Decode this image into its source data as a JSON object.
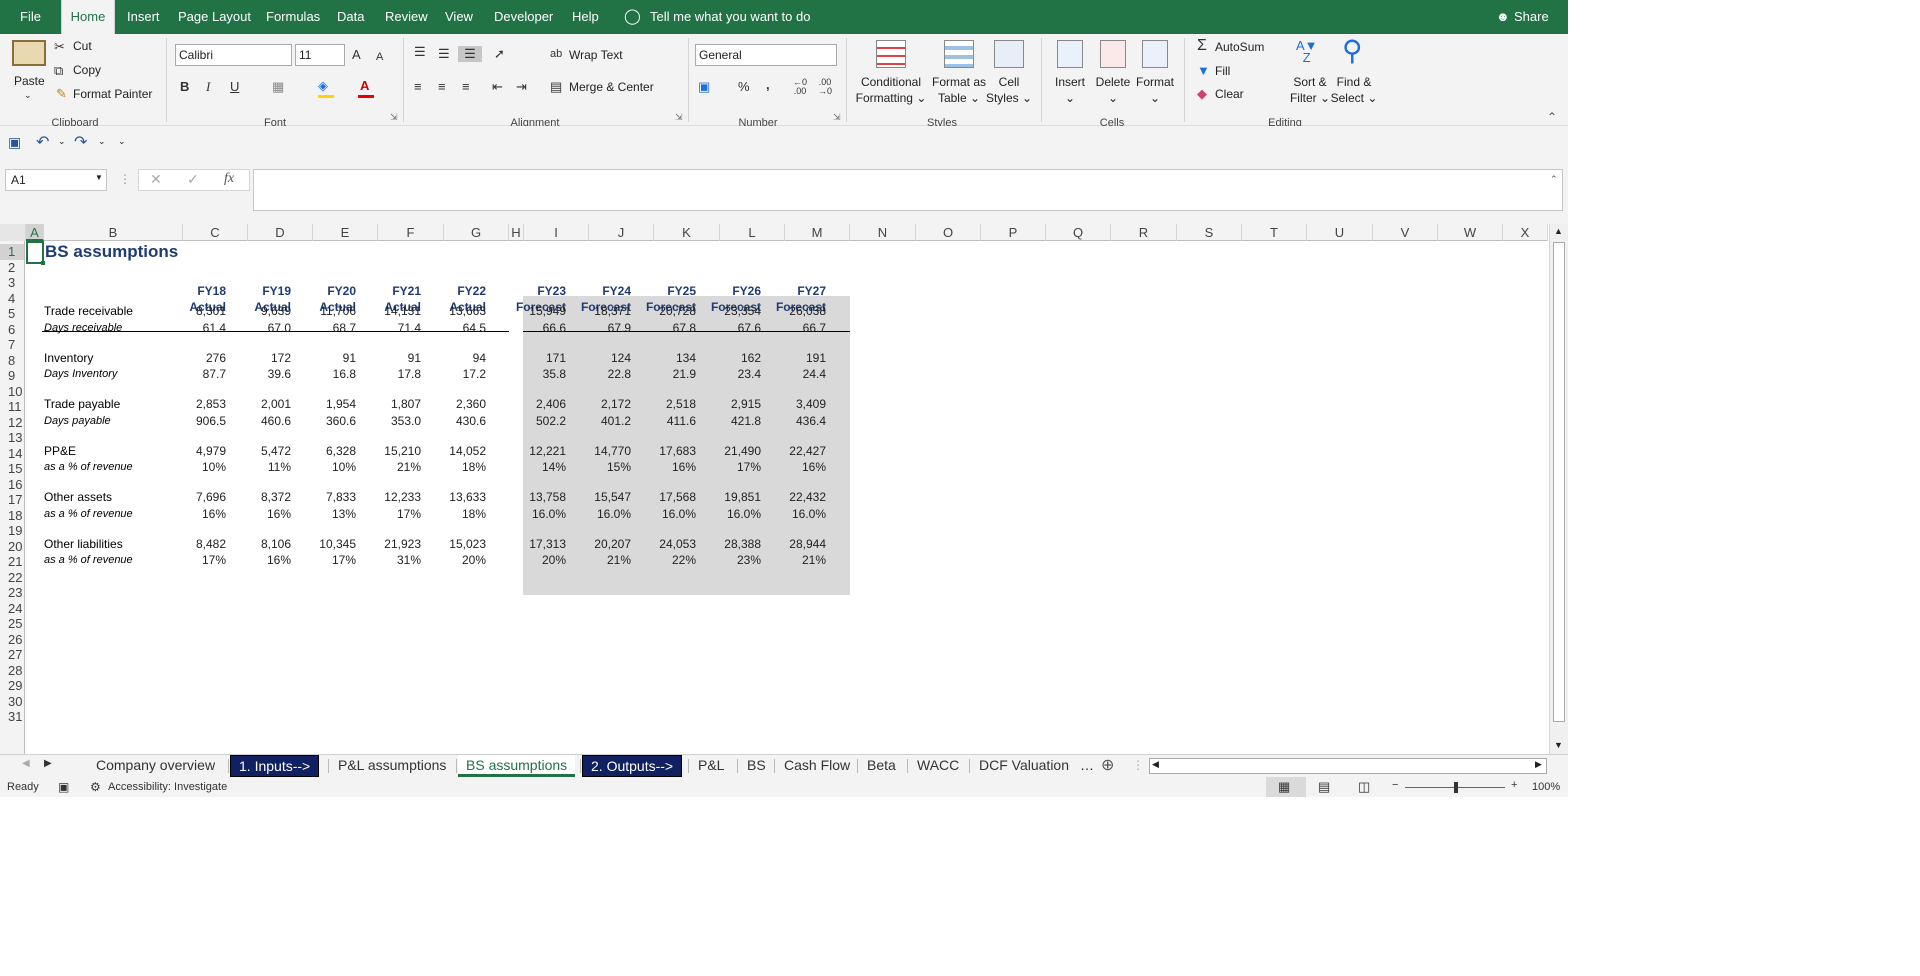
{
  "menu": {
    "tabs": [
      "File",
      "Home",
      "Insert",
      "Page Layout",
      "Formulas",
      "Data",
      "Review",
      "View",
      "Developer",
      "Help"
    ],
    "tell_me": "Tell me what you want to do",
    "share": "Share"
  },
  "ribbon": {
    "clipboard": {
      "paste": "Paste",
      "cut": "Cut",
      "copy": "Copy",
      "format_painter": "Format Painter",
      "label": "Clipboard"
    },
    "font": {
      "name": "Calibri",
      "size": "11",
      "label": "Font",
      "bold": "B",
      "italic": "I",
      "underline": "U",
      "grow": "A",
      "shrink": "A"
    },
    "alignment": {
      "wrap": "Wrap Text",
      "merge": "Merge & Center",
      "label": "Alignment"
    },
    "number": {
      "format": "General",
      "percent": "%",
      "comma": ",",
      "label": "Number"
    },
    "styles": {
      "conditional": "Conditional",
      "formatting": "Formatting",
      "format_as": "Format as",
      "table": "Table",
      "cell": "Cell",
      "cell_styles": "Styles",
      "label": "Styles"
    },
    "cells": {
      "insert": "Insert",
      "delete": "Delete",
      "format": "Format",
      "label": "Cells"
    },
    "editing": {
      "autosum": "AutoSum",
      "fill": "Fill",
      "clear": "Clear",
      "sort": "Sort &",
      "filter": "Filter",
      "find": "Find &",
      "select": "Select",
      "label": "Editing"
    }
  },
  "formula_bar": {
    "name_box": "A1",
    "fx": "fx",
    "value": ""
  },
  "columns": [
    "A",
    "B",
    "C",
    "D",
    "E",
    "F",
    "G",
    "H",
    "I",
    "J",
    "K",
    "L",
    "M",
    "N",
    "O",
    "P",
    "Q",
    "R",
    "S",
    "T",
    "U",
    "V",
    "W",
    "X"
  ],
  "rows": [
    "1",
    "2",
    "3",
    "4",
    "5",
    "6",
    "7",
    "8",
    "9",
    "10",
    "11",
    "12",
    "13",
    "14",
    "15",
    "16",
    "17",
    "18",
    "19",
    "20",
    "21",
    "22",
    "23",
    "24",
    "25",
    "26",
    "27",
    "28",
    "29",
    "30",
    "31"
  ],
  "sheet": {
    "title": "BS assumptions",
    "years": [
      {
        "fy": "FY18",
        "kind": "Actual"
      },
      {
        "fy": "FY19",
        "kind": "Actual"
      },
      {
        "fy": "FY20",
        "kind": "Actual"
      },
      {
        "fy": "FY21",
        "kind": "Actual"
      },
      {
        "fy": "FY22",
        "kind": "Actual"
      },
      {
        "fy": "FY23",
        "kind": "Forecast"
      },
      {
        "fy": "FY24",
        "kind": "Forecast"
      },
      {
        "fy": "FY25",
        "kind": "Forecast"
      },
      {
        "fy": "FY26",
        "kind": "Forecast"
      },
      {
        "fy": "FY27",
        "kind": "Forecast"
      }
    ],
    "blocks": [
      {
        "label": "Trade receivable",
        "values": [
          "8,301",
          "9,639",
          "11,706",
          "14,131",
          "13,663",
          "15,949",
          "18,371",
          "20,728",
          "23,354",
          "26,038"
        ],
        "sublabel": "Days receivable",
        "subvalues": [
          "61.4",
          "67.0",
          "68.7",
          "71.4",
          "64.5",
          "66.6",
          "67.9",
          "67.8",
          "67.6",
          "66.7"
        ]
      },
      {
        "label": "Inventory",
        "values": [
          "276",
          "172",
          "91",
          "91",
          "94",
          "171",
          "124",
          "134",
          "162",
          "191"
        ],
        "sublabel": "Days Inventory",
        "subvalues": [
          "87.7",
          "39.6",
          "16.8",
          "17.8",
          "17.2",
          "35.8",
          "22.8",
          "21.9",
          "23.4",
          "24.4"
        ]
      },
      {
        "label": "Trade payable",
        "values": [
          "2,853",
          "2,001",
          "1,954",
          "1,807",
          "2,360",
          "2,406",
          "2,172",
          "2,518",
          "2,915",
          "3,409"
        ],
        "sublabel": "Days payable",
        "subvalues": [
          "906.5",
          "460.6",
          "360.6",
          "353.0",
          "430.6",
          "502.2",
          "401.2",
          "411.6",
          "421.8",
          "436.4"
        ]
      },
      {
        "label": "PP&E",
        "values": [
          "4,979",
          "5,472",
          "6,328",
          "15,210",
          "14,052",
          "12,221",
          "14,770",
          "17,683",
          "21,490",
          "22,427"
        ],
        "sublabel": "as a % of revenue",
        "subvalues": [
          "10%",
          "11%",
          "10%",
          "21%",
          "18%",
          "14%",
          "15%",
          "16%",
          "17%",
          "16%"
        ]
      },
      {
        "label": "Other assets",
        "values": [
          "7,696",
          "8,372",
          "7,833",
          "12,233",
          "13,633",
          "13,758",
          "15,547",
          "17,568",
          "19,851",
          "22,432"
        ],
        "sublabel": "as a % of revenue",
        "subvalues": [
          "16%",
          "16%",
          "13%",
          "17%",
          "18%",
          "16.0%",
          "16.0%",
          "16.0%",
          "16.0%",
          "16.0%"
        ]
      },
      {
        "label": "Other liabilities",
        "values": [
          "8,482",
          "8,106",
          "10,345",
          "21,923",
          "15,023",
          "17,313",
          "20,207",
          "24,053",
          "28,388",
          "28,944"
        ],
        "sublabel": "as a % of revenue",
        "subvalues": [
          "17%",
          "16%",
          "17%",
          "31%",
          "20%",
          "20%",
          "21%",
          "22%",
          "23%",
          "21%"
        ]
      }
    ]
  },
  "sheet_tabs": [
    {
      "name": "Company overview",
      "style": "normal"
    },
    {
      "name": "1. Inputs-->",
      "style": "dark"
    },
    {
      "name": "P&L assumptions",
      "style": "normal"
    },
    {
      "name": "BS assumptions",
      "style": "active"
    },
    {
      "name": "2. Outputs-->",
      "style": "dark"
    },
    {
      "name": "P&L",
      "style": "normal"
    },
    {
      "name": "BS",
      "style": "normal"
    },
    {
      "name": "Cash Flow",
      "style": "normal"
    },
    {
      "name": "Beta",
      "style": "normal"
    },
    {
      "name": "WACC",
      "style": "normal"
    },
    {
      "name": "DCF Valuation",
      "style": "normal"
    }
  ],
  "status": {
    "ready": "Ready",
    "accessibility": "Accessibility: Investigate",
    "zoom": "100%"
  },
  "colors": {
    "accent": "#217346",
    "header_blue": "#1f3b73",
    "forecast_fill": "#d9d9d9",
    "dark_tab": "#102060"
  }
}
